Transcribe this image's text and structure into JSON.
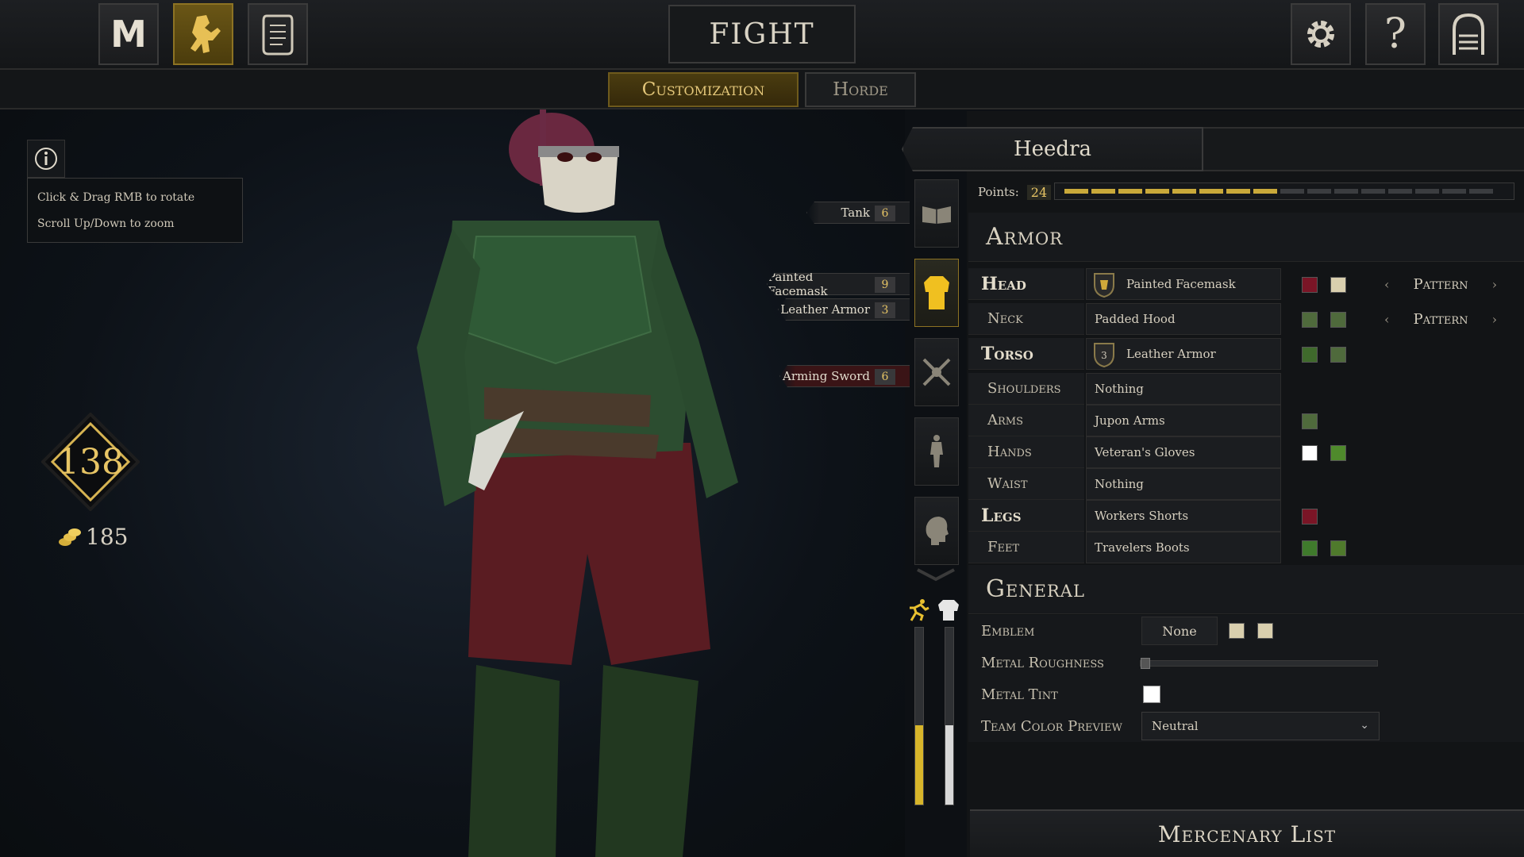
{
  "topbar": {
    "fight_label": "FIGHT",
    "left_buttons": [
      {
        "icon": "mordhau-logo-icon",
        "label": "M"
      },
      {
        "icon": "armored-warrior-icon"
      },
      {
        "icon": "scroll-icon"
      }
    ],
    "right_buttons": [
      {
        "icon": "gear-icon"
      },
      {
        "icon": "help-icon",
        "label": "?"
      },
      {
        "icon": "exit-door-icon"
      }
    ]
  },
  "tabs": [
    {
      "label": "Customization",
      "active": true
    },
    {
      "label": "Horde",
      "active": false
    }
  ],
  "help": {
    "icon": "info-icon",
    "lines": [
      "Click & Drag RMB to rotate",
      "Scroll Up/Down to zoom"
    ]
  },
  "stats": {
    "score": "138",
    "gold": "185",
    "gold_icon": "coins-icon"
  },
  "loadout_tags": [
    {
      "label": "Tank",
      "cost": "6"
    },
    {
      "label": "Painted Facemask",
      "cost": "9"
    },
    {
      "label": "Leather Armor",
      "cost": "3"
    },
    {
      "label": "Arming Sword",
      "cost": "6"
    }
  ],
  "side_nav": [
    {
      "icon": "book-icon",
      "active": false
    },
    {
      "icon": "armor-icon",
      "active": true
    },
    {
      "icon": "crossed-swords-icon",
      "active": false
    },
    {
      "icon": "body-icon",
      "active": false
    },
    {
      "icon": "head-icon",
      "active": false
    }
  ],
  "meters": {
    "speed_icon": "running-man-icon",
    "armor_icon": "armor-white-icon",
    "speed_level": 0.45,
    "armor_level": 0.45
  },
  "character": {
    "name": "Heedra"
  },
  "points": {
    "label": "Points:",
    "value": "24",
    "filled": 8,
    "total": 16
  },
  "armor": {
    "title": "Armor",
    "rows": [
      {
        "slot": "Head",
        "major": true,
        "item": "Painted Facemask",
        "icon": "head-armor-icon",
        "tier": "",
        "colors": [
          "#7a1526",
          "#d9cfae"
        ],
        "pattern": "Pattern"
      },
      {
        "slot": "Neck",
        "major": false,
        "item": "Padded Hood",
        "icon": "",
        "tier": "",
        "colors": [
          "#4f6a3c",
          "#4f6a3c"
        ],
        "pattern": "Pattern"
      },
      {
        "slot": "Torso",
        "major": true,
        "item": "Leather Armor",
        "icon": "shield-tier-icon",
        "tier": "3",
        "colors": [
          "#3f6a2c",
          "#4f6a3c"
        ],
        "pattern": ""
      },
      {
        "slot": "Shoulders",
        "major": false,
        "item": "Nothing",
        "icon": "",
        "tier": "",
        "colors": [],
        "pattern": ""
      },
      {
        "slot": "Arms",
        "major": false,
        "item": "Jupon Arms",
        "icon": "",
        "tier": "",
        "colors": [
          "#4f6a3c"
        ],
        "pattern": ""
      },
      {
        "slot": "Hands",
        "major": false,
        "item": "Veteran's Gloves",
        "icon": "",
        "tier": "",
        "colors": [
          "#ffffff",
          "#4f8a2c"
        ],
        "pattern": ""
      },
      {
        "slot": "Waist",
        "major": false,
        "item": "Nothing",
        "icon": "",
        "tier": "",
        "colors": [],
        "pattern": ""
      },
      {
        "slot": "Legs",
        "major": true,
        "item": "Workers Shorts",
        "icon": "",
        "tier": "",
        "colors": [
          "#7a1526"
        ],
        "pattern": ""
      },
      {
        "slot": "Feet",
        "major": false,
        "item": "Travelers Boots",
        "icon": "",
        "tier": "",
        "colors": [
          "#3f7a2c",
          "#4f7a2c"
        ],
        "pattern": ""
      }
    ]
  },
  "general": {
    "title": "General",
    "emblem_label": "Emblem",
    "emblem_value": "None",
    "emblem_colors": [
      "#d9cfae",
      "#d9cfae"
    ],
    "roughness_label": "Metal Roughness",
    "roughness_value": 0,
    "tint_label": "Metal Tint",
    "tint_color": "#ffffff",
    "team_label": "Team Color Preview",
    "team_value": "Neutral"
  },
  "mercenary_list": "Mercenary List"
}
